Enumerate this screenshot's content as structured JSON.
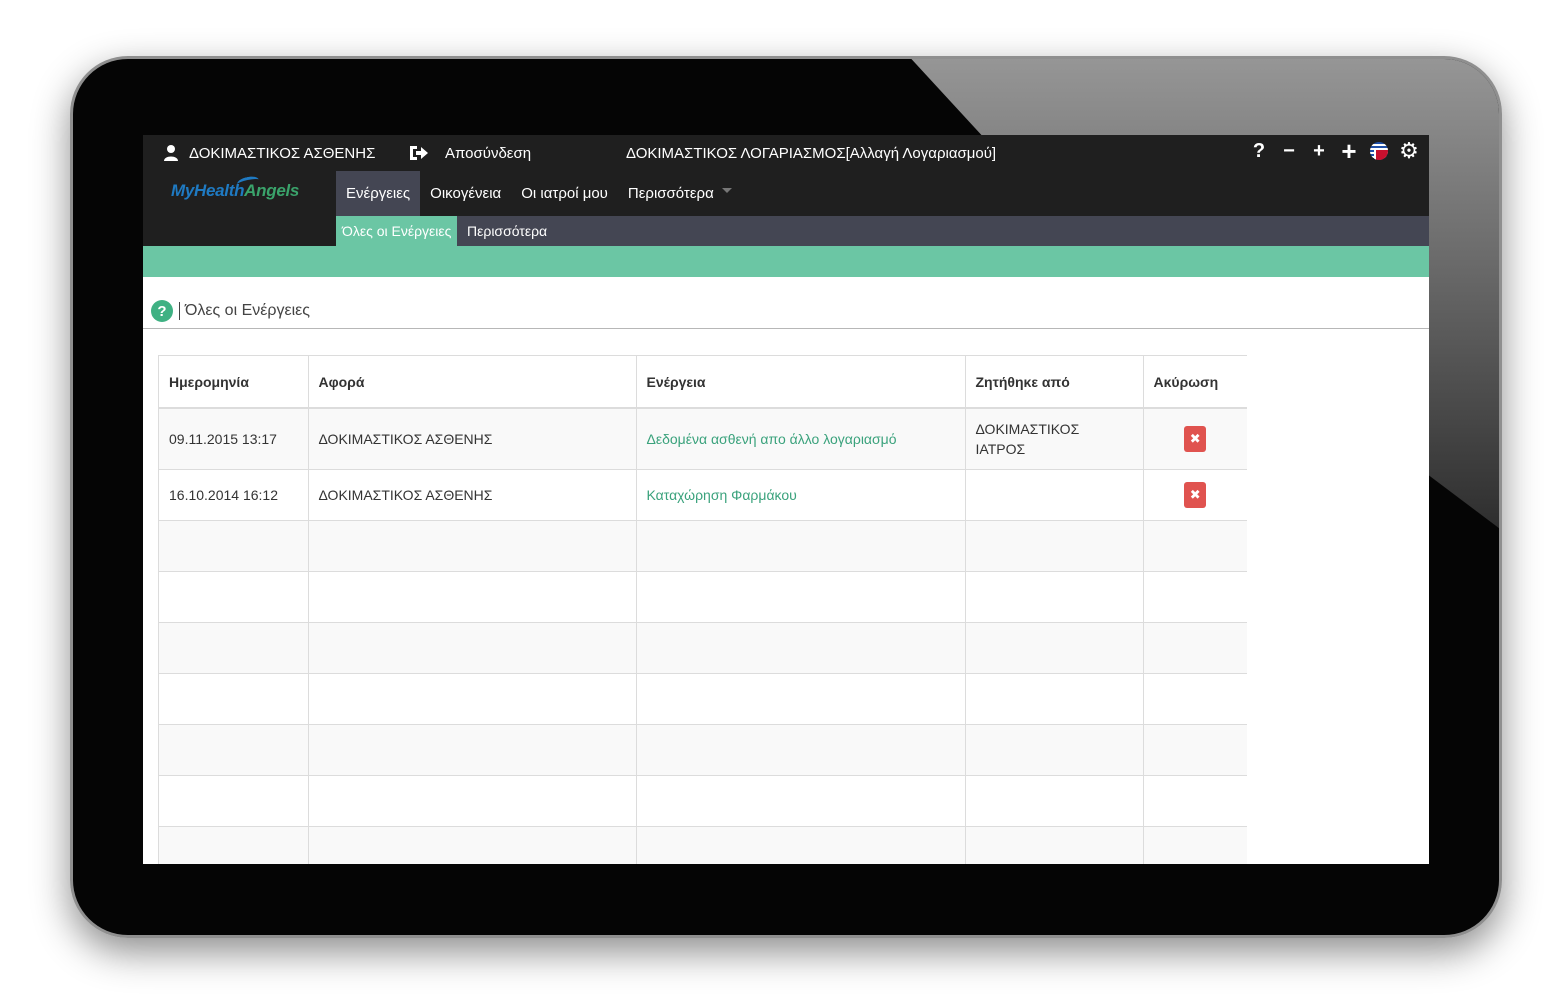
{
  "top_bar": {
    "user_name": "ΔΟΚΙΜΑΣΤΙΚΟΣ ΑΣΘΕΝΗΣ",
    "logout_label": "Αποσύνδεση",
    "account_label": "ΔΟΚΙΜΑΣΤΙΚΟΣ ΛΟΓΑΡΙΑΣΜΟΣ[Αλλαγή Λογαριασμού]",
    "icons": [
      "help-icon",
      "zoom-out-icon",
      "zoom-in-icon",
      "zoom-in-large-icon",
      "uk-flag-icon",
      "gear-icon"
    ],
    "glyphs": {
      "help": "?",
      "minus": "−",
      "plus": "+",
      "plus_large": "+",
      "gear": "⚙"
    }
  },
  "logo": {
    "part1": "MyHealth",
    "part2": "Angels"
  },
  "nav": {
    "tabs": [
      {
        "label": "Ενέργειες",
        "active": true
      },
      {
        "label": "Οικογένεια",
        "active": false
      },
      {
        "label": "Οι ιατροί μου",
        "active": false
      },
      {
        "label": "Περισσότερα",
        "active": false,
        "dropdown": true
      }
    ]
  },
  "sub_nav": {
    "tabs": [
      {
        "label": "Όλες οι Ενέργειες",
        "active": true
      },
      {
        "label": "Περισσότερα",
        "active": false
      }
    ]
  },
  "page": {
    "help_glyph": "?",
    "title": "Όλες οι Ενέργειες"
  },
  "table": {
    "columns": [
      "Ημερομηνία",
      "Αφορά",
      "Ενέργεια",
      "Ζητήθηκε από",
      "Ακύρωση"
    ],
    "rows": [
      {
        "date": "09.11.2015 13:17",
        "subject": "ΔΟΚΙΜΑΣΤΙΚΟΣ ΑΣΘΕΝΗΣ",
        "action": "Δεδομένα ασθενή απο άλλο λογαριασμό",
        "requested_by_line1": "ΔΟΚΙΜΑΣΤΙΚΟΣ",
        "requested_by_line2": "ΙΑΤΡΟΣ",
        "cancel_glyph": "✖"
      },
      {
        "date": "16.10.2014 16:12",
        "subject": "ΔΟΚΙΜΑΣΤΙΚΟΣ ΑΣΘΕΝΗΣ",
        "action": "Καταχώρηση Φαρμάκου",
        "requested_by_line1": "",
        "requested_by_line2": "",
        "cancel_glyph": "✖"
      }
    ],
    "empty_rows": 7
  },
  "colors": {
    "accent_green": "#6bc6a4",
    "link_green": "#3aa27c",
    "dark_bar": "#1f1f1f",
    "nav_active": "#444653",
    "delete_red": "#e0534f"
  }
}
